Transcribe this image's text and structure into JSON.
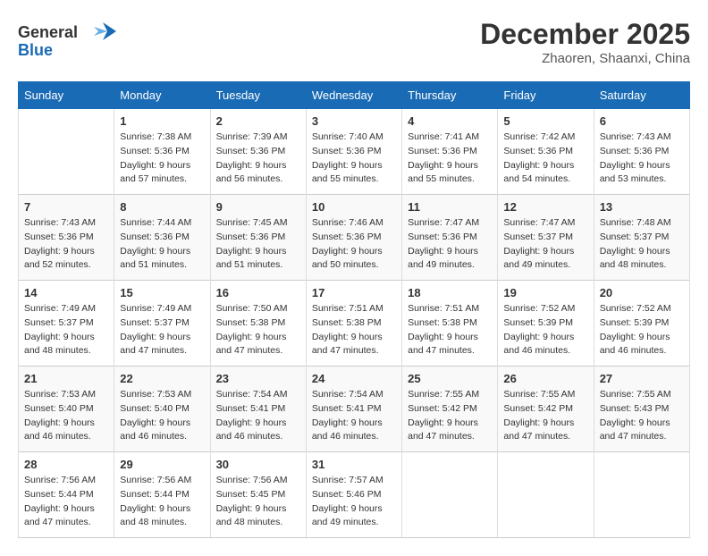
{
  "header": {
    "logo_line1": "General",
    "logo_line2": "Blue",
    "month_title": "December 2025",
    "subtitle": "Zhaoren, Shaanxi, China"
  },
  "days_of_week": [
    "Sunday",
    "Monday",
    "Tuesday",
    "Wednesday",
    "Thursday",
    "Friday",
    "Saturday"
  ],
  "weeks": [
    [
      {
        "day": "",
        "info": ""
      },
      {
        "day": "1",
        "info": "Sunrise: 7:38 AM\nSunset: 5:36 PM\nDaylight: 9 hours\nand 57 minutes."
      },
      {
        "day": "2",
        "info": "Sunrise: 7:39 AM\nSunset: 5:36 PM\nDaylight: 9 hours\nand 56 minutes."
      },
      {
        "day": "3",
        "info": "Sunrise: 7:40 AM\nSunset: 5:36 PM\nDaylight: 9 hours\nand 55 minutes."
      },
      {
        "day": "4",
        "info": "Sunrise: 7:41 AM\nSunset: 5:36 PM\nDaylight: 9 hours\nand 55 minutes."
      },
      {
        "day": "5",
        "info": "Sunrise: 7:42 AM\nSunset: 5:36 PM\nDaylight: 9 hours\nand 54 minutes."
      },
      {
        "day": "6",
        "info": "Sunrise: 7:43 AM\nSunset: 5:36 PM\nDaylight: 9 hours\nand 53 minutes."
      }
    ],
    [
      {
        "day": "7",
        "info": "Sunrise: 7:43 AM\nSunset: 5:36 PM\nDaylight: 9 hours\nand 52 minutes."
      },
      {
        "day": "8",
        "info": "Sunrise: 7:44 AM\nSunset: 5:36 PM\nDaylight: 9 hours\nand 51 minutes."
      },
      {
        "day": "9",
        "info": "Sunrise: 7:45 AM\nSunset: 5:36 PM\nDaylight: 9 hours\nand 51 minutes."
      },
      {
        "day": "10",
        "info": "Sunrise: 7:46 AM\nSunset: 5:36 PM\nDaylight: 9 hours\nand 50 minutes."
      },
      {
        "day": "11",
        "info": "Sunrise: 7:47 AM\nSunset: 5:36 PM\nDaylight: 9 hours\nand 49 minutes."
      },
      {
        "day": "12",
        "info": "Sunrise: 7:47 AM\nSunset: 5:37 PM\nDaylight: 9 hours\nand 49 minutes."
      },
      {
        "day": "13",
        "info": "Sunrise: 7:48 AM\nSunset: 5:37 PM\nDaylight: 9 hours\nand 48 minutes."
      }
    ],
    [
      {
        "day": "14",
        "info": "Sunrise: 7:49 AM\nSunset: 5:37 PM\nDaylight: 9 hours\nand 48 minutes."
      },
      {
        "day": "15",
        "info": "Sunrise: 7:49 AM\nSunset: 5:37 PM\nDaylight: 9 hours\nand 47 minutes."
      },
      {
        "day": "16",
        "info": "Sunrise: 7:50 AM\nSunset: 5:38 PM\nDaylight: 9 hours\nand 47 minutes."
      },
      {
        "day": "17",
        "info": "Sunrise: 7:51 AM\nSunset: 5:38 PM\nDaylight: 9 hours\nand 47 minutes."
      },
      {
        "day": "18",
        "info": "Sunrise: 7:51 AM\nSunset: 5:38 PM\nDaylight: 9 hours\nand 47 minutes."
      },
      {
        "day": "19",
        "info": "Sunrise: 7:52 AM\nSunset: 5:39 PM\nDaylight: 9 hours\nand 46 minutes."
      },
      {
        "day": "20",
        "info": "Sunrise: 7:52 AM\nSunset: 5:39 PM\nDaylight: 9 hours\nand 46 minutes."
      }
    ],
    [
      {
        "day": "21",
        "info": "Sunrise: 7:53 AM\nSunset: 5:40 PM\nDaylight: 9 hours\nand 46 minutes."
      },
      {
        "day": "22",
        "info": "Sunrise: 7:53 AM\nSunset: 5:40 PM\nDaylight: 9 hours\nand 46 minutes."
      },
      {
        "day": "23",
        "info": "Sunrise: 7:54 AM\nSunset: 5:41 PM\nDaylight: 9 hours\nand 46 minutes."
      },
      {
        "day": "24",
        "info": "Sunrise: 7:54 AM\nSunset: 5:41 PM\nDaylight: 9 hours\nand 46 minutes."
      },
      {
        "day": "25",
        "info": "Sunrise: 7:55 AM\nSunset: 5:42 PM\nDaylight: 9 hours\nand 47 minutes."
      },
      {
        "day": "26",
        "info": "Sunrise: 7:55 AM\nSunset: 5:42 PM\nDaylight: 9 hours\nand 47 minutes."
      },
      {
        "day": "27",
        "info": "Sunrise: 7:55 AM\nSunset: 5:43 PM\nDaylight: 9 hours\nand 47 minutes."
      }
    ],
    [
      {
        "day": "28",
        "info": "Sunrise: 7:56 AM\nSunset: 5:44 PM\nDaylight: 9 hours\nand 47 minutes."
      },
      {
        "day": "29",
        "info": "Sunrise: 7:56 AM\nSunset: 5:44 PM\nDaylight: 9 hours\nand 48 minutes."
      },
      {
        "day": "30",
        "info": "Sunrise: 7:56 AM\nSunset: 5:45 PM\nDaylight: 9 hours\nand 48 minutes."
      },
      {
        "day": "31",
        "info": "Sunrise: 7:57 AM\nSunset: 5:46 PM\nDaylight: 9 hours\nand 49 minutes."
      },
      {
        "day": "",
        "info": ""
      },
      {
        "day": "",
        "info": ""
      },
      {
        "day": "",
        "info": ""
      }
    ]
  ]
}
